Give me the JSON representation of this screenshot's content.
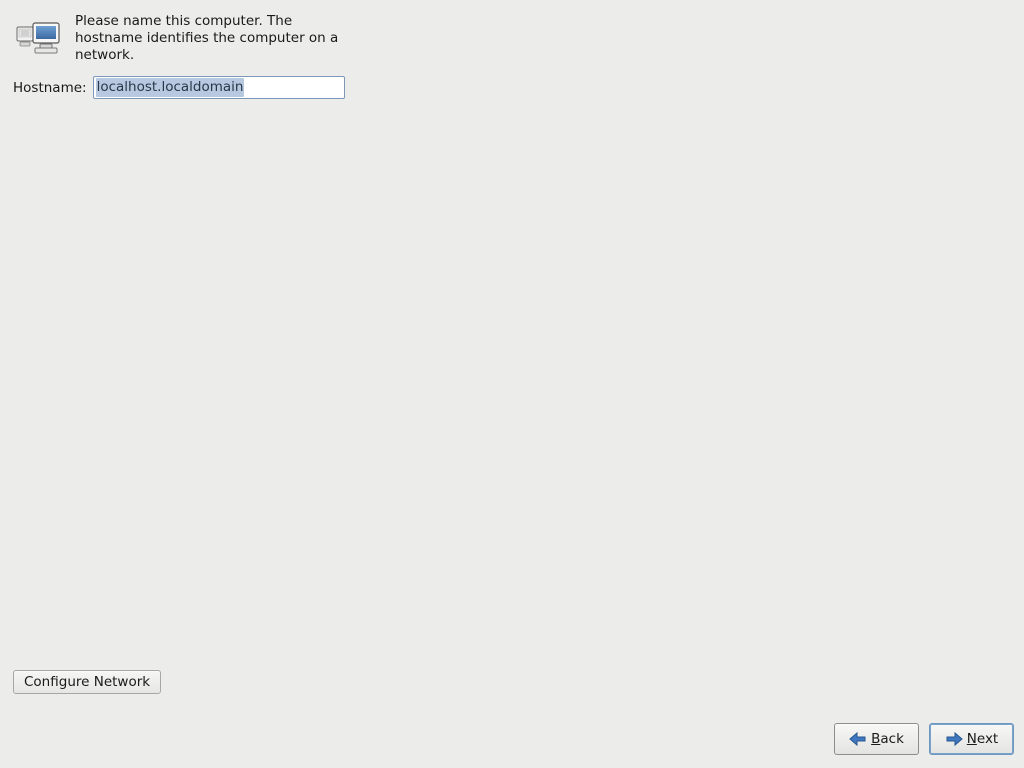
{
  "intro": "Please name this computer.  The hostname identifies the computer on a network.",
  "hostname_label": "Hostname:",
  "hostname_value": "localhost.localdomain",
  "configure_network_label": "Configure Network",
  "back": {
    "mnemonic": "B",
    "rest": "ack"
  },
  "next": {
    "mnemonic": "N",
    "rest": "ext"
  }
}
